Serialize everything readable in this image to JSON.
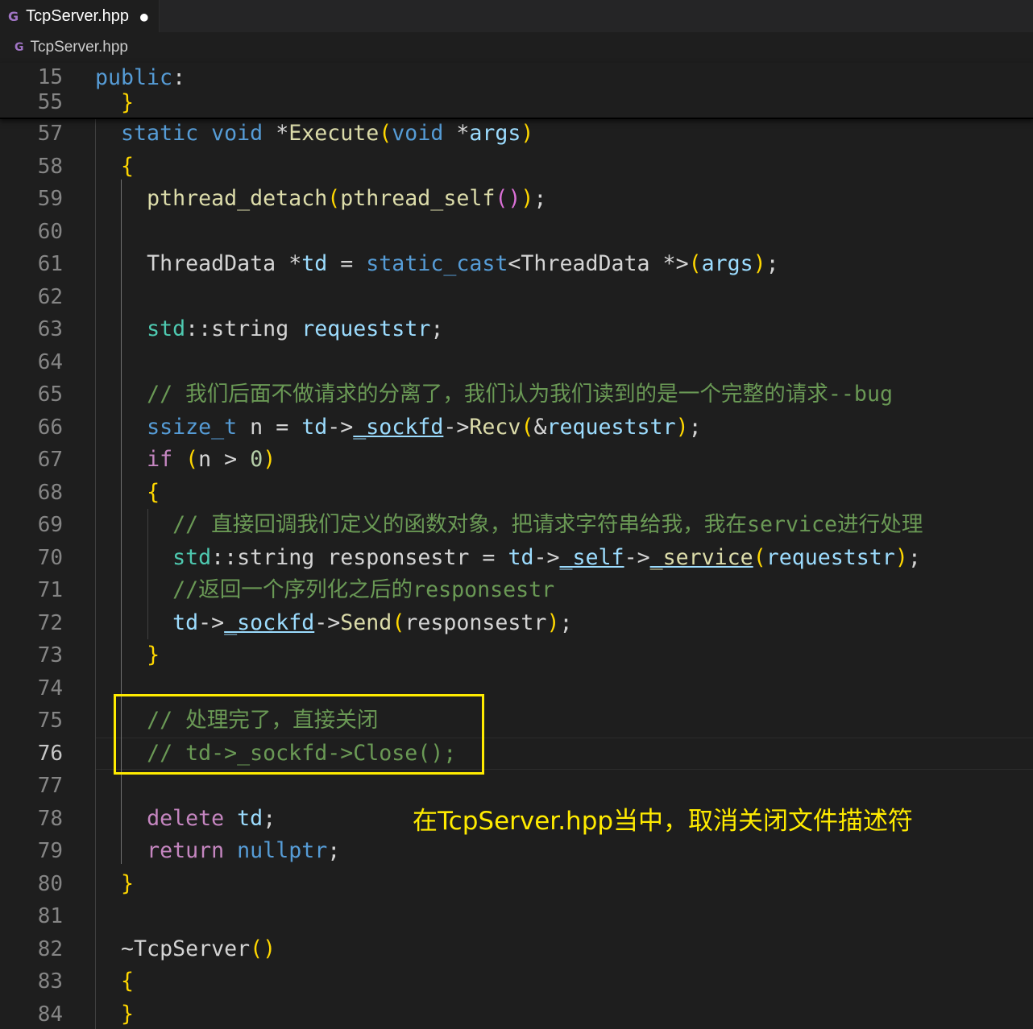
{
  "tab": {
    "title": "TcpServer.hpp",
    "dirty_marker": "●",
    "icon": "cpp-file-icon"
  },
  "breadcrumb": {
    "file": "TcpServer.hpp",
    "icon": "cpp-file-icon"
  },
  "sticky_scroll": [
    {
      "number": "15",
      "text": "public:"
    },
    {
      "number": "55",
      "text": "  }"
    }
  ],
  "editor": {
    "current_line": "76",
    "lines": [
      {
        "number": "57",
        "text": "  static void *Execute(void *args)"
      },
      {
        "number": "58",
        "text": "  {"
      },
      {
        "number": "59",
        "text": "    pthread_detach(pthread_self());"
      },
      {
        "number": "60",
        "text": ""
      },
      {
        "number": "61",
        "text": "    ThreadData *td = static_cast<ThreadData *>(args);"
      },
      {
        "number": "62",
        "text": ""
      },
      {
        "number": "63",
        "text": "    std::string requeststr;"
      },
      {
        "number": "64",
        "text": ""
      },
      {
        "number": "65",
        "text": "    // 我们后面不做请求的分离了，我们认为我们读到的是一个完整的请求--bug"
      },
      {
        "number": "66",
        "text": "    ssize_t n = td->_sockfd->Recv(&requeststr);"
      },
      {
        "number": "67",
        "text": "    if (n > 0)"
      },
      {
        "number": "68",
        "text": "    {"
      },
      {
        "number": "69",
        "text": "      // 直接回调我们定义的函数对象，把请求字符串给我，我在service进行处理"
      },
      {
        "number": "70",
        "text": "      std::string responsestr = td->_self->_service(requeststr);"
      },
      {
        "number": "71",
        "text": "      //返回一个序列化之后的responsestr"
      },
      {
        "number": "72",
        "text": "      td->_sockfd->Send(responsestr);"
      },
      {
        "number": "73",
        "text": "    }"
      },
      {
        "number": "74",
        "text": ""
      },
      {
        "number": "75",
        "text": "    // 处理完了，直接关闭"
      },
      {
        "number": "76",
        "text": "    // td->_sockfd->Close();"
      },
      {
        "number": "77",
        "text": ""
      },
      {
        "number": "78",
        "text": "    delete td;"
      },
      {
        "number": "79",
        "text": "    return nullptr;"
      },
      {
        "number": "80",
        "text": "  }"
      },
      {
        "number": "81",
        "text": ""
      },
      {
        "number": "82",
        "text": "  ~TcpServer()"
      },
      {
        "number": "83",
        "text": "  {"
      },
      {
        "number": "84",
        "text": "  }"
      }
    ]
  },
  "annotation": "在TcpServer.hpp当中，取消关闭文件描述符",
  "colors": {
    "background": "#1e1e1e",
    "keyword": "#569cd6",
    "control": "#c586c0",
    "function": "#dcdcaa",
    "type": "#4ec9b0",
    "variable": "#9cdcfe",
    "comment": "#6a9955",
    "highlight": "#ffeb00"
  }
}
